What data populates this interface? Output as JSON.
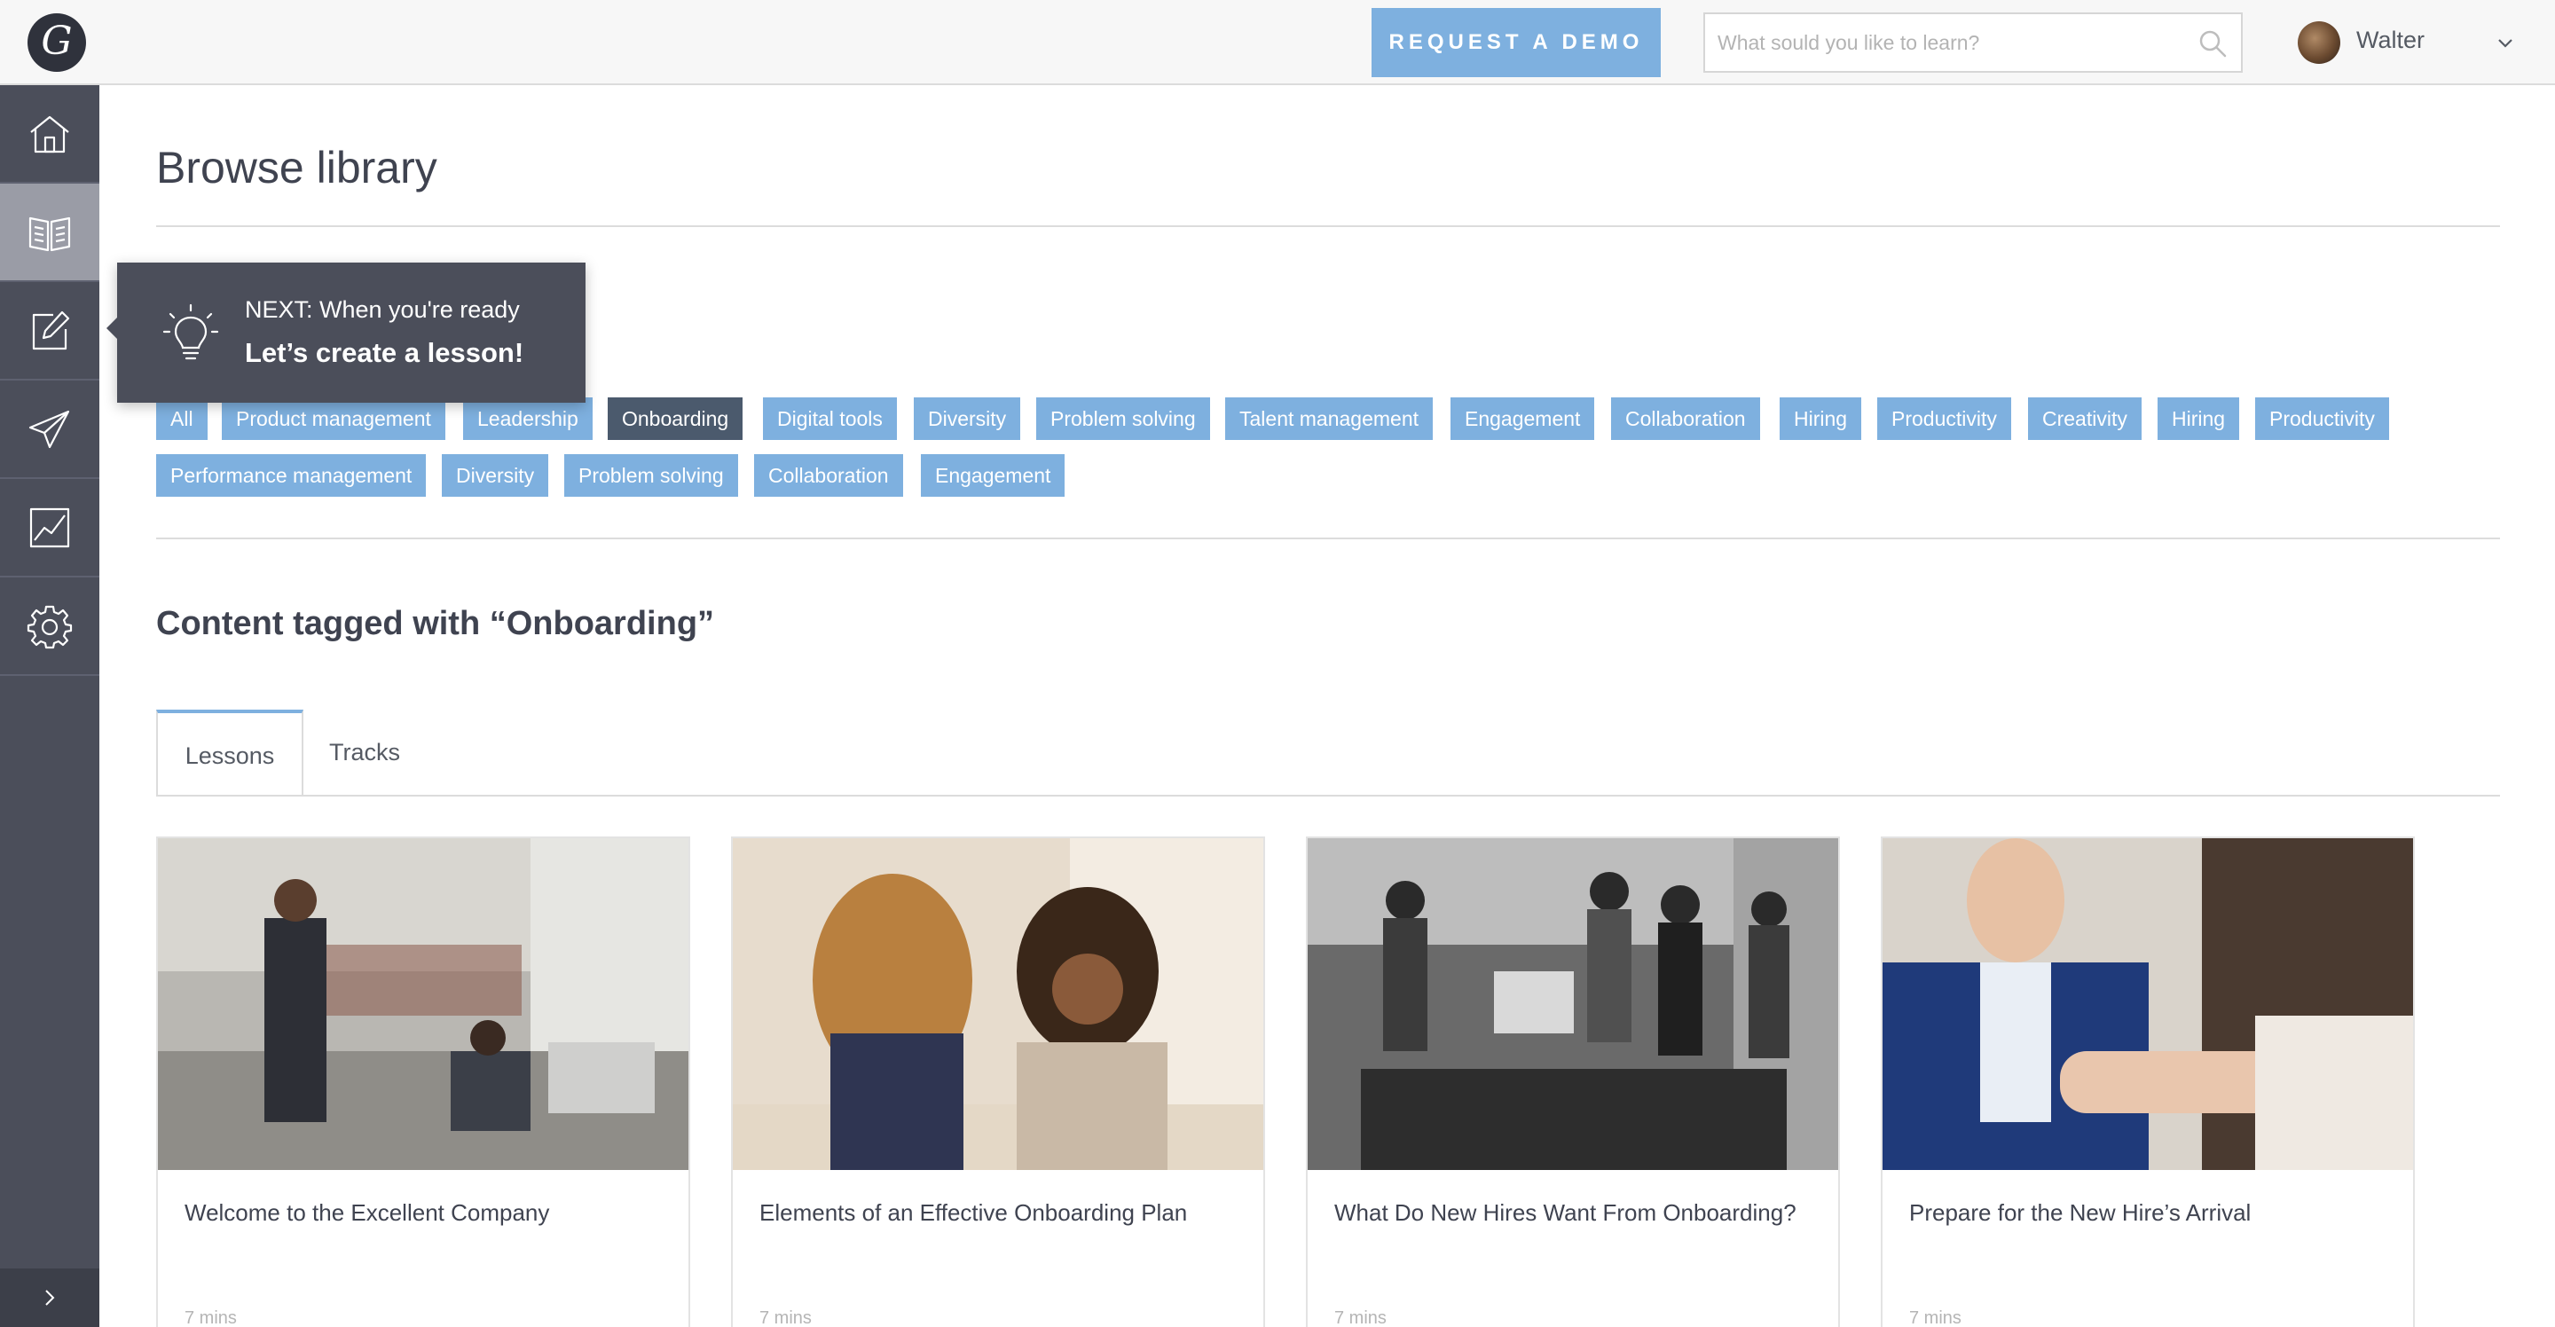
{
  "header": {
    "logo_letter": "G",
    "demo_label": "REQUEST A DEMO",
    "search_placeholder": "What sould you like to learn?",
    "search_value": "",
    "user_name": "Walter"
  },
  "sidebar": {
    "items": [
      {
        "name": "home",
        "icon": "home-icon"
      },
      {
        "name": "library",
        "icon": "book-icon",
        "active": true
      },
      {
        "name": "create",
        "icon": "edit-icon"
      },
      {
        "name": "send",
        "icon": "paper-plane-icon"
      },
      {
        "name": "analytics",
        "icon": "chart-icon"
      },
      {
        "name": "settings",
        "icon": "gear-icon"
      }
    ],
    "expand_icon": "chevron-right-icon"
  },
  "main": {
    "title": "Browse library",
    "tags_row1": [
      "All",
      "Product management",
      "Leadership",
      "Onboarding",
      "Digital tools",
      "Diversity",
      "Problem solving",
      "Talent management",
      "Engagement",
      "Collaboration",
      "Hiring",
      "Productivity",
      "Creativity",
      "Hiring",
      "Productivity"
    ],
    "tags_row2": [
      "Performance management",
      "Diversity",
      "Problem solving",
      "Collaboration",
      "Engagement"
    ],
    "selected_tag": "Onboarding",
    "section_title": "Content tagged with “Onboarding”",
    "tabs": [
      {
        "label": "Lessons",
        "active": true
      },
      {
        "label": "Tracks",
        "active": false
      }
    ],
    "cards": [
      {
        "title": "Welcome to the Excellent Company",
        "meta": "7 mins"
      },
      {
        "title": "Elements of an Effective Onboarding Plan",
        "meta": "7 mins"
      },
      {
        "title": "What Do New Hires Want From Onboarding?",
        "meta": "7 mins"
      },
      {
        "title": "Prepare for the New Hire’s Arrival",
        "meta": "7 mins"
      }
    ]
  },
  "tooltip": {
    "line1": "NEXT: When you're ready",
    "line2": "Let’s create a lesson!",
    "icon": "lightbulb-icon"
  },
  "colors": {
    "accent": "#7eb0df",
    "sidebar": "#4b4e5a",
    "selected_tag": "#4b5a6d"
  }
}
